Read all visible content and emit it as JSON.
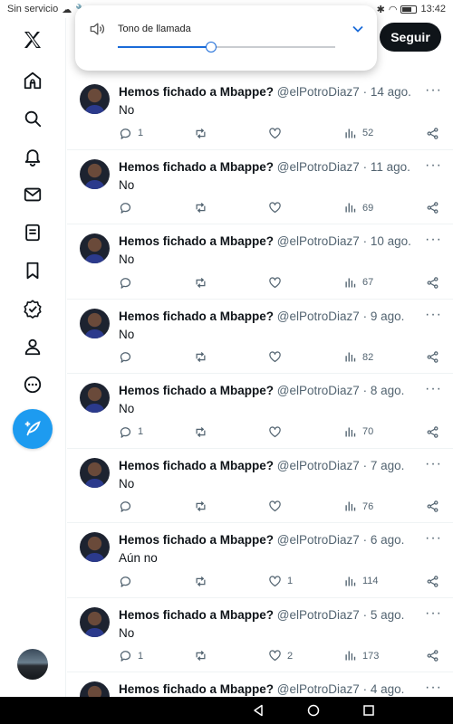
{
  "status_bar": {
    "carrier": "Sin servicio",
    "time": "13:42"
  },
  "volume_popup": {
    "label": "Tono de llamada",
    "level_percent": 43
  },
  "follow_button": {
    "label": "Seguir"
  },
  "colors": {
    "accent": "#1d9bf0",
    "text": "#0f1419",
    "muted": "#536471",
    "slider": "#1b6bd8"
  },
  "sidebar": {
    "items": [
      {
        "icon": "home-icon"
      },
      {
        "icon": "search-icon"
      },
      {
        "icon": "bell-icon"
      },
      {
        "icon": "mail-icon"
      },
      {
        "icon": "list-icon"
      },
      {
        "icon": "bookmark-icon"
      },
      {
        "icon": "verified-icon"
      },
      {
        "icon": "profile-icon"
      },
      {
        "icon": "more-circle-icon"
      }
    ]
  },
  "tweets": [
    {
      "name": "Hemos fichado a Mbappe?",
      "handle": "@elPotroDiaz7",
      "date": "14 ago.",
      "text": "No",
      "replies": "1",
      "retweets": "",
      "likes": "",
      "views": "52"
    },
    {
      "name": "Hemos fichado a Mbappe?",
      "handle": "@elPotroDiaz7",
      "date": "11 ago.",
      "text": "No",
      "replies": "",
      "retweets": "",
      "likes": "",
      "views": "69"
    },
    {
      "name": "Hemos fichado a Mbappe?",
      "handle": "@elPotroDiaz7",
      "date": "10 ago.",
      "text": "No",
      "replies": "",
      "retweets": "",
      "likes": "",
      "views": "67"
    },
    {
      "name": "Hemos fichado a Mbappe?",
      "handle": "@elPotroDiaz7",
      "date": "9 ago.",
      "text": "No",
      "replies": "",
      "retweets": "",
      "likes": "",
      "views": "82"
    },
    {
      "name": "Hemos fichado a Mbappe?",
      "handle": "@elPotroDiaz7",
      "date": "8 ago.",
      "text": "No",
      "replies": "1",
      "retweets": "",
      "likes": "",
      "views": "70"
    },
    {
      "name": "Hemos fichado a Mbappe?",
      "handle": "@elPotroDiaz7",
      "date": "7 ago.",
      "text": "No",
      "replies": "",
      "retweets": "",
      "likes": "",
      "views": "76"
    },
    {
      "name": "Hemos fichado a Mbappe?",
      "handle": "@elPotroDiaz7",
      "date": "6 ago.",
      "text": "Aún no",
      "replies": "",
      "retweets": "",
      "likes": "1",
      "views": "114"
    },
    {
      "name": "Hemos fichado a Mbappe?",
      "handle": "@elPotroDiaz7",
      "date": "5 ago.",
      "text": "No",
      "replies": "1",
      "retweets": "",
      "likes": "2",
      "views": "173"
    },
    {
      "name": "Hemos fichado a Mbappe?",
      "handle": "@elPotroDiaz7",
      "date": "4 ago.",
      "text": "",
      "replies": "",
      "retweets": "",
      "likes": "",
      "views": ""
    }
  ]
}
